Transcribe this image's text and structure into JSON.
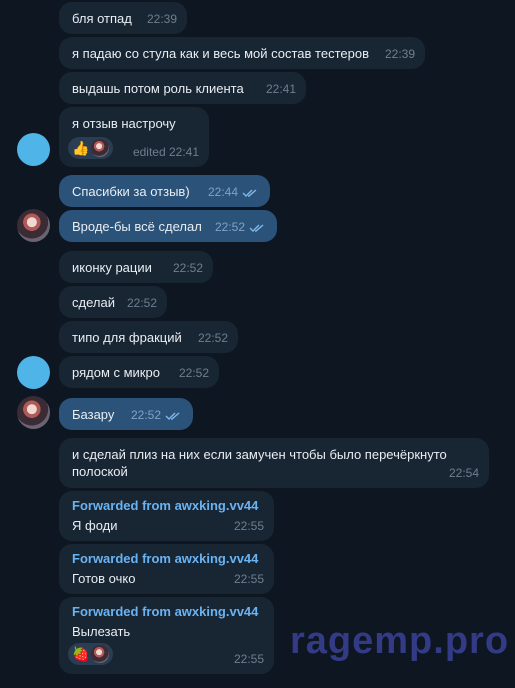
{
  "messages": [
    {
      "text": "бля отпад",
      "time": "22:39"
    },
    {
      "text": "я падаю со стула как и весь мой состав тестеров",
      "time": "22:39"
    },
    {
      "text": "выдашь потом роль клиента",
      "time": "22:41"
    },
    {
      "text": "я отзыв настрочу",
      "time": "edited 22:41",
      "reactions": [
        "👍"
      ]
    },
    {
      "text": "Спасибки за отзыв)",
      "time": "22:44"
    },
    {
      "text": "Вроде-бы всё сделал",
      "time": "22:52"
    },
    {
      "text": "иконку рации",
      "time": "22:52"
    },
    {
      "text": "сделай",
      "time": "22:52"
    },
    {
      "text": "типо для фракций",
      "time": "22:52"
    },
    {
      "text": "рядом с микро",
      "time": "22:52"
    },
    {
      "text": "Базару",
      "time": "22:52"
    },
    {
      "text_line1": "и сделай плиз на них если замучен чтобы было перечёркнуто",
      "text_line2": "полоской",
      "time": "22:54"
    }
  ],
  "forwarded": [
    {
      "label": "Forwarded from awxking.vv44",
      "text": "Я фоди",
      "time": "22:55"
    },
    {
      "label": "Forwarded from awxking.vv44",
      "text": "Готов очко",
      "time": "22:55"
    },
    {
      "label": "Forwarded from awxking.vv44",
      "text": "Вылезать",
      "time": "22:55",
      "reactions": [
        "🍓"
      ]
    }
  ],
  "watermark": "ragemp.pro",
  "colors": {
    "background": "#0e1621",
    "incoming": "#182533",
    "outgoing": "#2b5278",
    "link": "#6ab3f3"
  }
}
